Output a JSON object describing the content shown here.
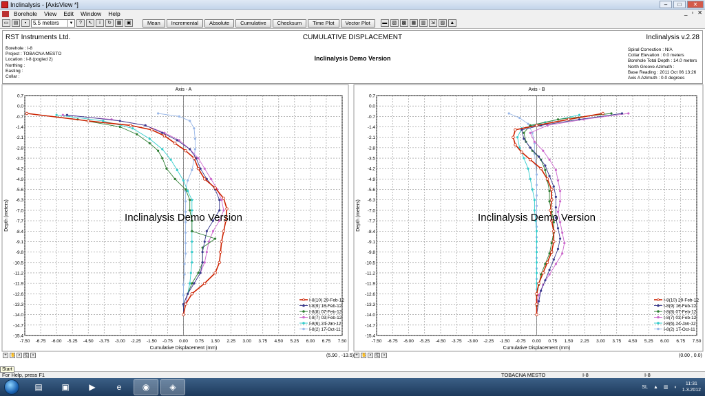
{
  "window": {
    "title": "Inclinalysis - [AxisView *]"
  },
  "menu": {
    "items": [
      "Borehole",
      "View",
      "Edit",
      "Window",
      "Help"
    ]
  },
  "toolbar": {
    "depth_value": "5.5 meters",
    "buttons": [
      "Mean",
      "Incremental",
      "Absolute",
      "Cumulative",
      "Checksum",
      "Time Plot",
      "Vector Plot"
    ]
  },
  "header": {
    "company": "RST Instruments Ltd.",
    "title": "CUMULATIVE DISPLACEMENT",
    "version": "Inclinalysis v.2.28",
    "demo": "Inclinalysis Demo Version",
    "left_fields": [
      "Borehole : I-8",
      "Project : TOBACNA MESTO",
      "Location : I-8 (pogled 2)",
      "Northing :",
      "Easting :",
      "Collar :"
    ],
    "right_fields": [
      "Spiral Correction : N/A",
      "Collar Elevation : 0.0 meters",
      "Borehole Total Depth : 14.0 meters",
      "North Groove Azimuth :",
      "Base Reading : 2011 Oct 06 13:26",
      "Axis A Azimuth : 0.0 degrees"
    ]
  },
  "plots": {
    "y_label": "Depth (meters)",
    "x_label": "Cumulative Displacement (mm)",
    "watermark": "Inclinalysis Demo Version",
    "y_ticks": [
      "0.7",
      "0.0",
      "-0.7",
      "-1.4",
      "-2.1",
      "-2.8",
      "-3.5",
      "-4.2",
      "-4.9",
      "-5.6",
      "-6.3",
      "-7.0",
      "-7.7",
      "-8.4",
      "-9.1",
      "-9.8",
      "-10.5",
      "-11.2",
      "-11.9",
      "-12.6",
      "-13.3",
      "-14.0",
      "-14.7",
      "-15.4"
    ],
    "x_ticks": [
      "-7.50",
      "-6.75",
      "-6.00",
      "-5.25",
      "-4.50",
      "-3.75",
      "-3.00",
      "-2.25",
      "-1.50",
      "-0.75",
      "0.00",
      "0.75",
      "1.50",
      "2.25",
      "3.00",
      "3.75",
      "4.50",
      "5.25",
      "6.00",
      "6.75",
      "7.50"
    ],
    "legend": [
      "I-8(10) 29-Feb-12",
      "I-8(9) 16-Feb-12",
      "I-8(8) 07-Feb-12",
      "I-8(7) 03-Feb-12",
      "I-8(6) 24-Jan-12",
      "I-8(2) 17-Oct-11"
    ],
    "colors": [
      "#cc2200",
      "#3a3a8c",
      "#2e7d32",
      "#cc66cc",
      "#33cccc",
      "#9ab8e8"
    ],
    "a": {
      "title": "Axis - A",
      "coord": "(5.90 , -13.5)",
      "series": [
        [
          [
            -7.4,
            -0.5
          ],
          [
            -4.5,
            -1.0
          ],
          [
            -2.5,
            -1.3
          ],
          [
            -1.5,
            -1.6
          ],
          [
            -0.9,
            -2.0
          ],
          [
            -0.4,
            -2.5
          ],
          [
            0.1,
            -3.0
          ],
          [
            0.5,
            -3.5
          ],
          [
            0.7,
            -4.2
          ],
          [
            1.0,
            -4.9
          ],
          [
            1.5,
            -5.5
          ],
          [
            1.9,
            -6.2
          ],
          [
            2.05,
            -6.9
          ],
          [
            2.0,
            -7.7
          ],
          [
            1.9,
            -8.4
          ],
          [
            1.8,
            -9.1
          ],
          [
            1.75,
            -9.8
          ],
          [
            1.7,
            -10.5
          ],
          [
            1.5,
            -11.2
          ],
          [
            1.0,
            -11.9
          ],
          [
            0.4,
            -12.6
          ],
          [
            0.1,
            -13.3
          ],
          [
            0.0,
            -14.0
          ]
        ],
        [
          [
            -5.5,
            -0.6
          ],
          [
            -3.0,
            -1.0
          ],
          [
            -1.8,
            -1.3
          ],
          [
            -1.0,
            -1.8
          ],
          [
            -0.3,
            -2.3
          ],
          [
            0.3,
            -2.9
          ],
          [
            0.6,
            -3.5
          ],
          [
            0.8,
            -4.2
          ],
          [
            1.1,
            -4.9
          ],
          [
            1.5,
            -5.6
          ],
          [
            1.7,
            -6.3
          ],
          [
            1.7,
            -7.0
          ],
          [
            1.4,
            -7.7
          ],
          [
            1.1,
            -8.4
          ],
          [
            1.0,
            -9.1
          ],
          [
            0.9,
            -9.8
          ],
          [
            0.9,
            -10.5
          ],
          [
            0.8,
            -11.2
          ],
          [
            0.5,
            -11.9
          ],
          [
            0.2,
            -12.6
          ],
          [
            0.0,
            -13.3
          ],
          [
            0.0,
            -14.0
          ]
        ],
        [
          [
            -7.4,
            -0.5
          ],
          [
            -5.0,
            -0.9
          ],
          [
            -3.0,
            -1.4
          ],
          [
            -2.2,
            -1.9
          ],
          [
            -1.6,
            -2.5
          ],
          [
            -1.2,
            -3.0
          ],
          [
            -1.0,
            -3.5
          ],
          [
            -0.8,
            -4.2
          ],
          [
            -0.4,
            -4.9
          ],
          [
            0.1,
            -5.6
          ],
          [
            0.3,
            -6.3
          ],
          [
            0.3,
            -7.0
          ],
          [
            0.4,
            -7.7
          ],
          [
            0.4,
            -8.4
          ],
          [
            1.5,
            -8.9
          ],
          [
            0.9,
            -9.5
          ],
          [
            0.9,
            -10.5
          ],
          [
            0.7,
            -11.2
          ],
          [
            0.4,
            -11.9
          ],
          [
            0.2,
            -12.6
          ],
          [
            0.0,
            -13.3
          ],
          [
            0.0,
            -14.0
          ]
        ],
        [
          [
            -5.7,
            -0.6
          ],
          [
            -3.4,
            -0.9
          ],
          [
            -1.8,
            -1.3
          ],
          [
            -0.9,
            -1.8
          ],
          [
            -0.2,
            -2.3
          ],
          [
            0.3,
            -2.9
          ],
          [
            0.7,
            -3.5
          ],
          [
            1.0,
            -4.2
          ],
          [
            1.3,
            -4.9
          ],
          [
            1.6,
            -5.6
          ],
          [
            1.8,
            -6.3
          ],
          [
            1.9,
            -7.0
          ],
          [
            1.7,
            -7.7
          ],
          [
            1.4,
            -8.4
          ],
          [
            1.2,
            -9.1
          ],
          [
            1.1,
            -9.8
          ],
          [
            1.0,
            -10.5
          ],
          [
            0.8,
            -11.2
          ],
          [
            0.5,
            -11.9
          ],
          [
            0.2,
            -12.6
          ],
          [
            0.1,
            -13.3
          ],
          [
            0.0,
            -14.0
          ]
        ],
        [
          [
            -6.0,
            -0.6
          ],
          [
            -3.8,
            -1.0
          ],
          [
            -2.4,
            -1.5
          ],
          [
            -1.6,
            -2.2
          ],
          [
            -1.0,
            -2.9
          ],
          [
            -0.6,
            -3.6
          ],
          [
            -0.3,
            -4.3
          ],
          [
            0.0,
            -5.0
          ],
          [
            0.2,
            -5.7
          ],
          [
            0.4,
            -6.3
          ],
          [
            0.4,
            -7.0
          ],
          [
            0.4,
            -7.7
          ],
          [
            0.4,
            -8.4
          ],
          [
            0.4,
            -9.1
          ],
          [
            0.4,
            -9.8
          ],
          [
            0.4,
            -10.5
          ],
          [
            0.35,
            -11.2
          ],
          [
            0.3,
            -11.9
          ],
          [
            0.2,
            -12.6
          ],
          [
            0.1,
            -13.3
          ],
          [
            0.0,
            -14.0
          ]
        ],
        [
          [
            -1.2,
            -0.5
          ],
          [
            -0.2,
            -0.7
          ],
          [
            0.3,
            -1.0
          ],
          [
            0.5,
            -1.5
          ],
          [
            0.55,
            -2.2
          ],
          [
            0.55,
            -2.9
          ],
          [
            0.5,
            -3.6
          ],
          [
            0.4,
            -4.3
          ],
          [
            0.2,
            -5.0
          ],
          [
            0.1,
            -5.7
          ],
          [
            0.1,
            -6.4
          ],
          [
            0.1,
            -7.1
          ],
          [
            0.1,
            -7.8
          ],
          [
            0.1,
            -8.5
          ],
          [
            0.1,
            -9.2
          ],
          [
            0.1,
            -9.9
          ],
          [
            0.05,
            -10.6
          ],
          [
            0.05,
            -11.3
          ],
          [
            0.0,
            -12.0
          ],
          [
            0.0,
            -12.7
          ],
          [
            0.0,
            -13.4
          ],
          [
            0.0,
            -14.0
          ]
        ]
      ]
    },
    "b": {
      "title": "Axis - B",
      "coord": "(0.00 , 0.0)",
      "series": [
        [
          [
            3.1,
            -0.5
          ],
          [
            1.5,
            -0.9
          ],
          [
            0.0,
            -1.3
          ],
          [
            -1.0,
            -1.6
          ],
          [
            -1.1,
            -2.1
          ],
          [
            -1.0,
            -2.6
          ],
          [
            -0.7,
            -3.1
          ],
          [
            -0.3,
            -3.6
          ],
          [
            0.2,
            -4.2
          ],
          [
            0.5,
            -4.9
          ],
          [
            0.7,
            -5.6
          ],
          [
            0.7,
            -6.3
          ],
          [
            0.65,
            -7.0
          ],
          [
            0.7,
            -7.7
          ],
          [
            0.8,
            -8.4
          ],
          [
            0.8,
            -9.1
          ],
          [
            0.7,
            -9.8
          ],
          [
            0.5,
            -10.5
          ],
          [
            0.3,
            -11.2
          ],
          [
            0.1,
            -11.9
          ],
          [
            0.0,
            -12.6
          ],
          [
            0.0,
            -13.3
          ],
          [
            0.0,
            -14.0
          ]
        ],
        [
          [
            4.0,
            -0.5
          ],
          [
            2.0,
            -0.9
          ],
          [
            0.2,
            -1.3
          ],
          [
            -0.7,
            -1.6
          ],
          [
            -0.6,
            -2.2
          ],
          [
            -0.3,
            -2.8
          ],
          [
            0.1,
            -3.4
          ],
          [
            0.4,
            -4.0
          ],
          [
            0.6,
            -4.7
          ],
          [
            0.8,
            -5.4
          ],
          [
            0.9,
            -6.1
          ],
          [
            0.9,
            -6.8
          ],
          [
            0.9,
            -7.5
          ],
          [
            1.0,
            -8.2
          ],
          [
            1.1,
            -8.9
          ],
          [
            1.0,
            -9.6
          ],
          [
            0.8,
            -10.3
          ],
          [
            0.6,
            -11.0
          ],
          [
            0.4,
            -11.7
          ],
          [
            0.2,
            -12.4
          ],
          [
            0.1,
            -13.1
          ],
          [
            0.0,
            -14.0
          ]
        ],
        [
          [
            3.5,
            -0.5
          ],
          [
            1.0,
            -0.9
          ],
          [
            -0.3,
            -1.3
          ],
          [
            -0.6,
            -1.8
          ],
          [
            -0.5,
            -2.4
          ],
          [
            -0.2,
            -3.0
          ],
          [
            0.2,
            -3.6
          ],
          [
            0.4,
            -4.3
          ],
          [
            0.5,
            -5.0
          ],
          [
            0.6,
            -5.7
          ],
          [
            0.6,
            -6.4
          ],
          [
            0.7,
            -7.1
          ],
          [
            0.8,
            -7.8
          ],
          [
            0.8,
            -8.5
          ],
          [
            0.7,
            -9.2
          ],
          [
            0.6,
            -9.9
          ],
          [
            0.4,
            -10.6
          ],
          [
            0.2,
            -11.3
          ],
          [
            0.1,
            -12.0
          ],
          [
            0.0,
            -12.7
          ],
          [
            0.0,
            -13.4
          ],
          [
            0.0,
            -14.0
          ]
        ],
        [
          [
            4.3,
            -0.5
          ],
          [
            2.2,
            -0.9
          ],
          [
            0.5,
            -1.3
          ],
          [
            -0.3,
            -1.8
          ],
          [
            -0.1,
            -2.4
          ],
          [
            0.3,
            -3.0
          ],
          [
            0.6,
            -3.6
          ],
          [
            0.9,
            -4.3
          ],
          [
            1.0,
            -5.0
          ],
          [
            1.1,
            -5.7
          ],
          [
            1.1,
            -6.4
          ],
          [
            1.0,
            -7.1
          ],
          [
            1.1,
            -7.8
          ],
          [
            1.2,
            -8.5
          ],
          [
            1.3,
            -9.2
          ],
          [
            1.2,
            -9.9
          ],
          [
            0.9,
            -10.6
          ],
          [
            0.6,
            -11.3
          ],
          [
            0.3,
            -12.0
          ],
          [
            0.1,
            -12.7
          ],
          [
            0.0,
            -13.4
          ],
          [
            0.0,
            -14.0
          ]
        ],
        [
          [
            2.0,
            -0.6
          ],
          [
            0.4,
            -1.1
          ],
          [
            -0.7,
            -1.5
          ],
          [
            -0.9,
            -2.1
          ],
          [
            -0.8,
            -2.8
          ],
          [
            -0.6,
            -3.5
          ],
          [
            -0.4,
            -4.2
          ],
          [
            -0.3,
            -4.9
          ],
          [
            -0.2,
            -5.6
          ],
          [
            -0.1,
            -6.3
          ],
          [
            -0.1,
            -7.0
          ],
          [
            -0.05,
            -7.7
          ],
          [
            0.0,
            -8.4
          ],
          [
            0.0,
            -9.1
          ],
          [
            0.0,
            -9.8
          ],
          [
            0.0,
            -10.5
          ],
          [
            0.0,
            -11.2
          ],
          [
            0.0,
            -11.9
          ],
          [
            0.0,
            -12.6
          ],
          [
            0.0,
            -13.3
          ],
          [
            0.0,
            -14.0
          ]
        ],
        [
          [
            -1.3,
            -0.5
          ],
          [
            -0.8,
            -0.8
          ],
          [
            -0.4,
            -1.2
          ],
          [
            -0.2,
            -1.8
          ],
          [
            -0.1,
            -2.5
          ],
          [
            -0.1,
            -3.2
          ],
          [
            -0.05,
            -3.9
          ],
          [
            0.0,
            -4.6
          ],
          [
            0.0,
            -5.3
          ],
          [
            0.0,
            -6.0
          ],
          [
            0.0,
            -6.7
          ],
          [
            0.0,
            -7.4
          ],
          [
            0.0,
            -8.1
          ],
          [
            0.0,
            -8.8
          ],
          [
            0.0,
            -9.5
          ],
          [
            0.0,
            -10.2
          ],
          [
            0.0,
            -10.9
          ],
          [
            0.0,
            -11.6
          ],
          [
            0.0,
            -12.3
          ],
          [
            0.0,
            -13.0
          ],
          [
            0.0,
            -14.0
          ]
        ]
      ]
    }
  },
  "statusbar": {
    "help": "For Help, press F1",
    "project": "TOBACNA MESTO",
    "borehole1": "I-8",
    "borehole2": "I-8",
    "start_tip": "Start"
  },
  "taskbar": {
    "lang": "SL",
    "time": "11:31",
    "date": "1.3.2012"
  }
}
